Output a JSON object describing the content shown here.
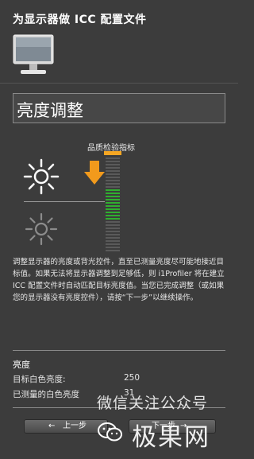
{
  "header": {
    "title": "为显示器做 ICC 配置文件",
    "icon": "monitor-icon"
  },
  "section": {
    "title": "亮度调整"
  },
  "meter": {
    "label": "品质检验指标",
    "marker_color": "#f5a623",
    "green_color": "#2fae2f",
    "idle_color": "#5a5a5a",
    "arrow_color": "#f29a1c",
    "icons": [
      "sun-bright-icon",
      "sun-dim-icon",
      "arrow-down-icon"
    ]
  },
  "description": "调整显示器的亮度或背光控件，直至已测量亮度尽可能地接近目标值。如果无法将显示器调整到足够低，则 i1Profiler 将在建立 ICC 配置文件时自动匹配目标亮度值。当您已完成调整（或如果您的显示器没有亮度控件），请按“下一步”以继续操作。",
  "brightness": {
    "heading": "亮度",
    "target_label": "目标白色亮度:",
    "target_value": "250",
    "measured_label": "已测量的白色亮度",
    "measured_value": "31"
  },
  "nav": {
    "prev_label": "上一步",
    "prev_glyph": "←",
    "next_label": "下一步",
    "next_glyph": "→"
  },
  "watermark": {
    "line1": "微信关注公众号",
    "line2": "极果网",
    "icon": "wechat-logo-icon"
  }
}
